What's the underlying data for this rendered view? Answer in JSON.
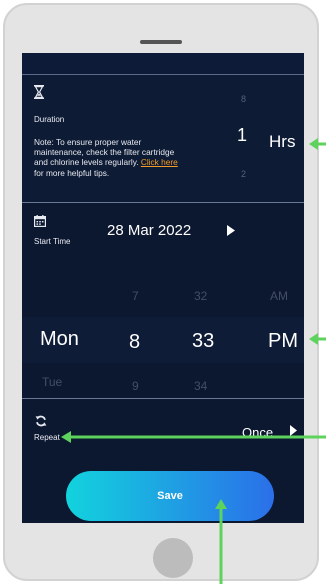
{
  "duration": {
    "label": "Duration",
    "note_text": "Note: To ensure proper water maintenance, check the filter cartridge and chlorine levels regularly. ",
    "note_link": "Click here",
    "note_suffix": " for more helpful tips.",
    "hours_above": "8",
    "hours_selected": "1",
    "hours_below": "2",
    "unit": "Hrs"
  },
  "start_time": {
    "label": "Start Time",
    "date": "28 Mar 2022",
    "day_above": "",
    "day_selected": "Mon",
    "day_below": "Tue",
    "hour_above": "7",
    "hour_selected": "8",
    "hour_below": "9",
    "minute_above": "32",
    "minute_selected": "33",
    "minute_below": "34",
    "ampm_above": "AM",
    "ampm_selected": "PM"
  },
  "repeat": {
    "label": "Repeat",
    "value": "Once"
  },
  "save": {
    "label": "Save"
  },
  "colors": {
    "accent_start": "#12d3dd",
    "accent_end": "#2b6fe9",
    "link": "#f39a27",
    "annotation": "#5dd35d"
  },
  "icons": [
    "hourglass-icon",
    "calendar-icon",
    "chevron-right-icon",
    "refresh-icon"
  ]
}
